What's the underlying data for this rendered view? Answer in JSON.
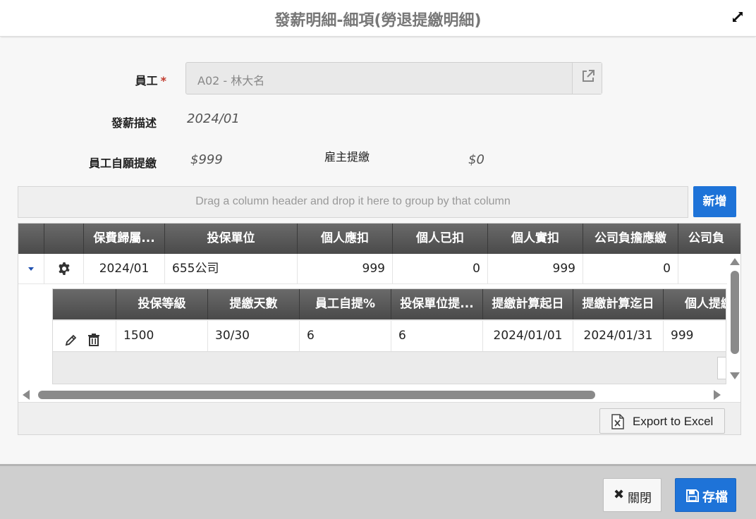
{
  "window": {
    "title": "發薪明細-細項(勞退提繳明細)"
  },
  "form": {
    "employee_label": "員工",
    "required_mark": "*",
    "employee_value": "A02 - 林大名",
    "description_label": "發薪描述",
    "description_value": "2024/01",
    "voluntary_label": "員工自願提繳",
    "voluntary_value": "$999",
    "employer_label": "雇主提繳",
    "employer_value": "$0"
  },
  "grid": {
    "group_hint": "Drag a column header and drop it here to group by that column",
    "add_label": "新增",
    "columns": [
      "保費歸屬...",
      "投保單位",
      "個人應扣",
      "個人已扣",
      "個人實扣",
      "公司負擔應繳",
      "公司負"
    ],
    "row": {
      "period": "2024/01",
      "unit": "655公司",
      "personal_due": "999",
      "personal_deducted": "0",
      "personal_actual": "999",
      "company_due": "0"
    },
    "sub_columns": [
      "投保等級",
      "提繳天數",
      "員工自提%",
      "投保單位提...",
      "提繳計算起日",
      "提繳計算迄日",
      "個人提繳"
    ],
    "sub_row": {
      "grade": "1500",
      "days": "30/30",
      "employee_pct": "6",
      "unit_pct": "6",
      "start_date": "2024/01/01",
      "end_date": "2024/01/31",
      "personal_amount": "999"
    },
    "export_label": "Export to Excel"
  },
  "footer": {
    "close_label": "關閉",
    "save_label": "存檔"
  },
  "colors": {
    "accent": "#1e73d8",
    "header": "#555555",
    "required": "#c0392b"
  }
}
